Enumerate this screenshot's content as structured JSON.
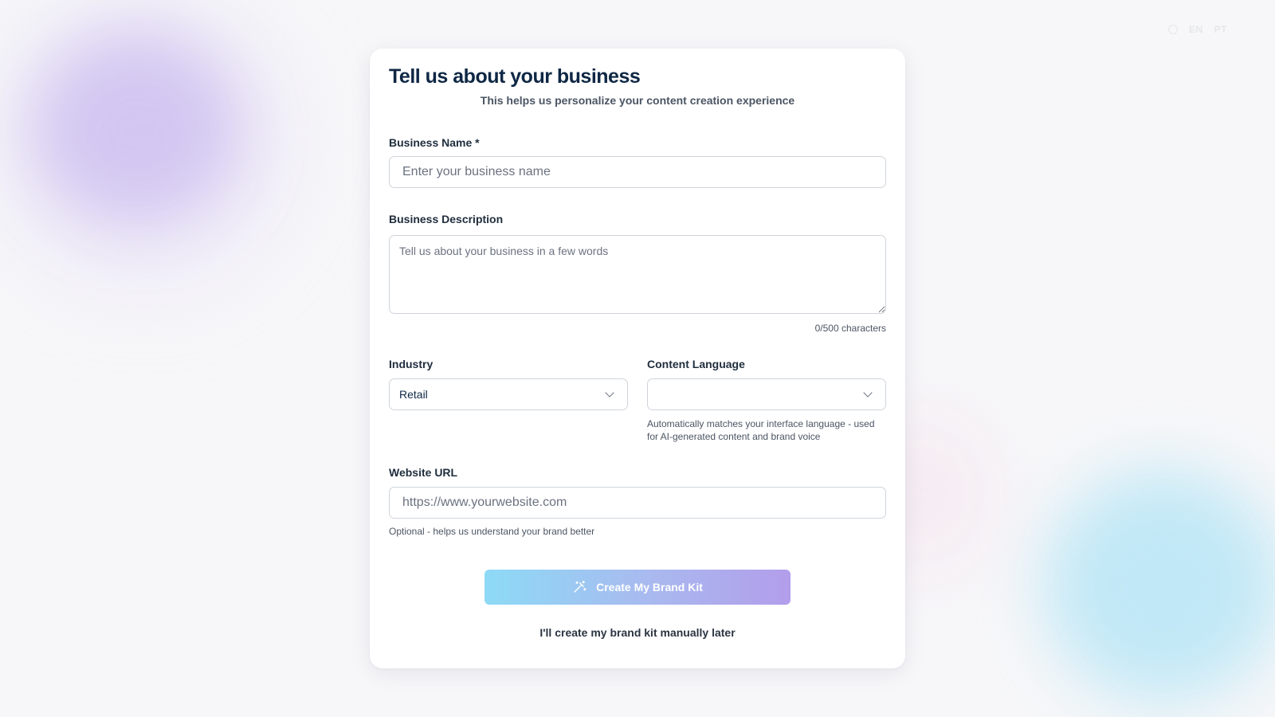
{
  "header": {
    "languages": [
      "EN",
      "PT"
    ]
  },
  "form": {
    "title": "Tell us about your business",
    "subtitle": "This helps us personalize your content creation experience",
    "business_name": {
      "label": "Business Name *",
      "value": "",
      "placeholder": "Enter your business name"
    },
    "business_description": {
      "label": "Business Description",
      "value": "",
      "placeholder": "Tell us about your business in a few words",
      "counter": "0/500 characters"
    },
    "industry": {
      "label": "Industry",
      "selected": "Retail"
    },
    "content_language": {
      "label": "Content Language",
      "selected": "",
      "helper": "Automatically matches your interface language - used for AI-generated content and brand voice"
    },
    "website": {
      "label": "Website URL",
      "value": "",
      "placeholder": "https://www.yourwebsite.com",
      "helper": "Optional - helps us understand your brand better"
    },
    "primary_button": {
      "label": "Create My Brand Kit",
      "icon": "magic-wand-icon"
    },
    "secondary_link": "I'll create my brand kit manually later"
  },
  "colors": {
    "title": "#0e2744",
    "gradient_start": "#8ddaf6",
    "gradient_end": "#b29deb",
    "card_bg": "#ffffff",
    "page_bg": "#f7f7f9"
  }
}
